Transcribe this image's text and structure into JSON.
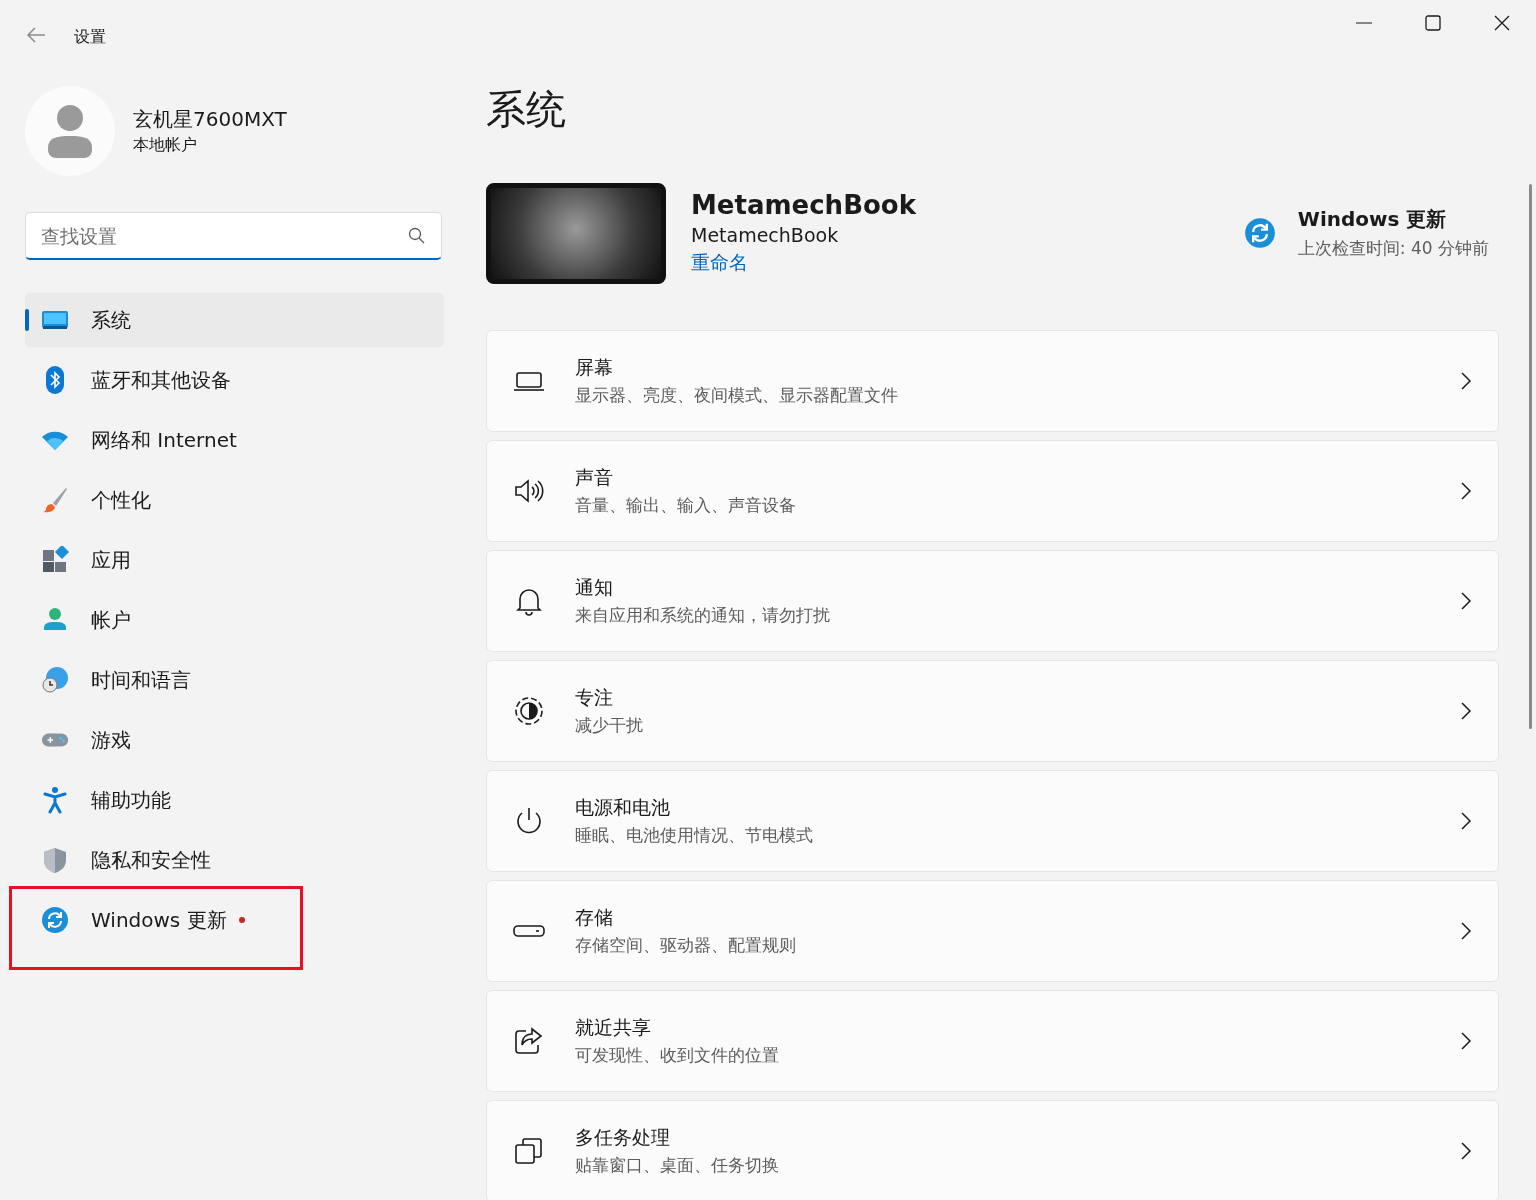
{
  "window": {
    "title": "设置"
  },
  "account": {
    "name": "玄机星7600MXT",
    "type": "本地帐户"
  },
  "search": {
    "placeholder": "查找设置"
  },
  "nav": [
    {
      "label": "系统",
      "selected": true,
      "notice": false,
      "highlighted": false
    },
    {
      "label": "蓝牙和其他设备",
      "selected": false,
      "notice": false,
      "highlighted": false
    },
    {
      "label": "网络和 Internet",
      "selected": false,
      "notice": false,
      "highlighted": false
    },
    {
      "label": "个性化",
      "selected": false,
      "notice": false,
      "highlighted": false
    },
    {
      "label": "应用",
      "selected": false,
      "notice": false,
      "highlighted": false
    },
    {
      "label": "帐户",
      "selected": false,
      "notice": false,
      "highlighted": false
    },
    {
      "label": "时间和语言",
      "selected": false,
      "notice": false,
      "highlighted": false
    },
    {
      "label": "游戏",
      "selected": false,
      "notice": false,
      "highlighted": false
    },
    {
      "label": "辅助功能",
      "selected": false,
      "notice": false,
      "highlighted": false
    },
    {
      "label": "隐私和安全性",
      "selected": false,
      "notice": false,
      "highlighted": false
    },
    {
      "label": "Windows 更新",
      "selected": false,
      "notice": true,
      "highlighted": true
    }
  ],
  "page_title": "系统",
  "device": {
    "name": "MetamechBook",
    "model": "MetamechBook",
    "rename_link": "重命名"
  },
  "update": {
    "title": "Windows 更新",
    "status": "上次检查时间: 40 分钟前"
  },
  "settings": [
    {
      "title": "屏幕",
      "subtitle": "显示器、亮度、夜间模式、显示器配置文件"
    },
    {
      "title": "声音",
      "subtitle": "音量、输出、输入、声音设备"
    },
    {
      "title": "通知",
      "subtitle": "来自应用和系统的通知，请勿打扰"
    },
    {
      "title": "专注",
      "subtitle": "减少干扰"
    },
    {
      "title": "电源和电池",
      "subtitle": "睡眠、电池使用情况、节电模式"
    },
    {
      "title": "存储",
      "subtitle": "存储空间、驱动器、配置规则"
    },
    {
      "title": "就近共享",
      "subtitle": "可发现性、收到文件的位置"
    },
    {
      "title": "多任务处理",
      "subtitle": "贴靠窗口、桌面、任务切换"
    }
  ]
}
